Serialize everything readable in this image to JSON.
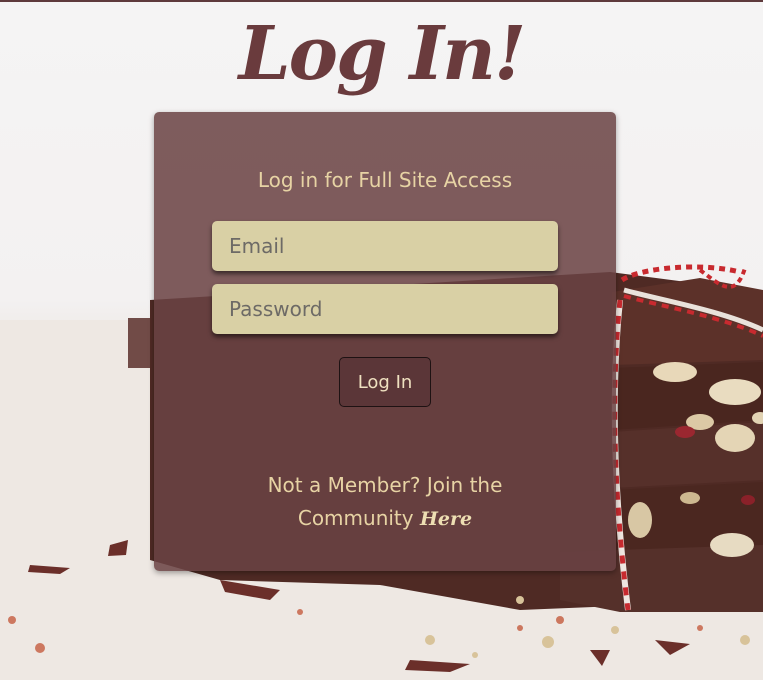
{
  "page": {
    "title": "Log In!"
  },
  "card": {
    "subtitle": "Log in for Full Site Access",
    "email_placeholder": "Email",
    "password_placeholder": "Password",
    "login_label": "Log In",
    "join_prefix": "Not a Member? Join the Community",
    "join_link": "Here"
  },
  "colors": {
    "title": "#6a3b3d",
    "card_background": "#6a4244",
    "field_background": "#d9d0a5",
    "text_accent": "#e7d3a4"
  }
}
